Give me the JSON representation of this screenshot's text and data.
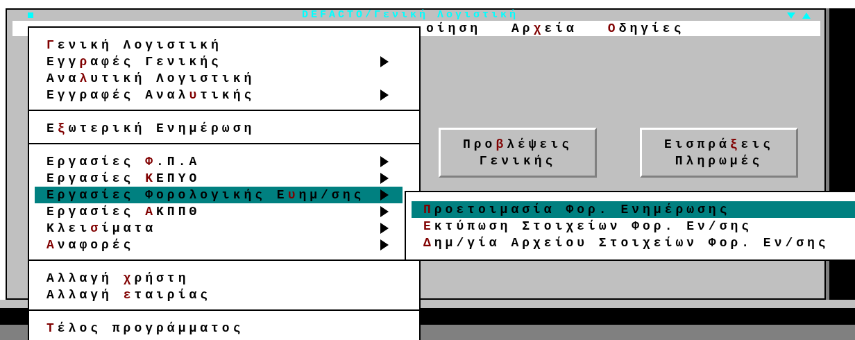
{
  "window": {
    "title": "DEFACTO/Γενική Λογιστική"
  },
  "menu_bar": [
    {
      "post": "οίηση"
    },
    {
      "pre": "Αρ",
      "key": "χ",
      "post": "εία"
    },
    {
      "key": "Ο",
      "post": "δηγίες"
    }
  ],
  "buttons": [
    {
      "lines": [
        {
          "pre": "Προ",
          "key": "β",
          "post": "λέψεις"
        },
        {
          "post": "Γενικής"
        }
      ]
    },
    {
      "lines": [
        {
          "pre": "Εισπρά",
          "key": "ξ",
          "post": "εις"
        },
        {
          "post": "Πληρωμές"
        }
      ]
    }
  ],
  "dropdown": {
    "groups": [
      {
        "items": [
          {
            "key": "Γ",
            "post": "ενική Λογιστική",
            "submenu": false,
            "selected": false
          },
          {
            "pre": "Εγγ",
            "key": "ρ",
            "post": "αφές Γενικής",
            "submenu": true,
            "selected": false
          },
          {
            "pre": "Ανα",
            "key": "λ",
            "post": "υτική Λογιστική",
            "submenu": false,
            "selected": false
          },
          {
            "pre": "Εγγραφές Αναλ",
            "key": "υ",
            "post": "τικής",
            "submenu": true,
            "selected": false
          }
        ]
      },
      {
        "items": [
          {
            "pre": "Ε",
            "key": "ξ",
            "post": "ωτερική Ενημέρωση",
            "submenu": false,
            "selected": false
          }
        ]
      },
      {
        "items": [
          {
            "pre": "Εργασίες ",
            "key": "Φ",
            "post": ".Π.Α",
            "submenu": true,
            "selected": false
          },
          {
            "pre": "Εργασίες ",
            "key": "Κ",
            "post": "ΕΠΥΟ",
            "submenu": true,
            "selected": false
          },
          {
            "pre": "Εργασίες Φορολογικής Ε",
            "key": "υ",
            "post": "ημ/σης",
            "submenu": true,
            "selected": true
          },
          {
            "pre": "Εργασίες ",
            "key": "Α",
            "post": "ΚΠΠΘ",
            "submenu": true,
            "selected": false
          },
          {
            "pre": "Κλει",
            "key": "σ",
            "post": "ίματα",
            "submenu": true,
            "selected": false
          },
          {
            "key": "Α",
            "post": "ναφορές",
            "submenu": true,
            "selected": false
          }
        ]
      },
      {
        "items": [
          {
            "pre": "Αλλαγή ",
            "key": "χ",
            "post": "ρήστη",
            "submenu": false,
            "selected": false
          },
          {
            "pre": "Αλλαγή ",
            "key": "ε",
            "post": "ταιρίας",
            "submenu": false,
            "selected": false
          }
        ]
      },
      {
        "items": [
          {
            "key": "Τ",
            "post": "έλος προγράμματος",
            "submenu": false,
            "selected": false
          }
        ]
      }
    ]
  },
  "submenu": {
    "items": [
      {
        "key": "Π",
        "post": "ροετοιμασία Φορ. Ενημέρωσης",
        "selected": true
      },
      {
        "key": "Ε",
        "post": "κτύπωση Στοιχείων Φορ. Εν/σης",
        "selected": false
      },
      {
        "key": "Δ",
        "post": "ημ/γία Αρχείου Στοιχείων Φορ. Εν/σης",
        "selected": false
      }
    ]
  }
}
